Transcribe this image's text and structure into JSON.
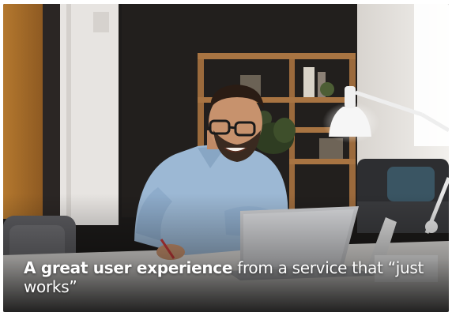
{
  "caption": {
    "bold_text": "A great user experience",
    "regular_text": "from a service that “just works”"
  },
  "image": {
    "subject": "smiling man with glasses writing at a desk in front of a laptop",
    "colors": {
      "shirt": "#9cb8d4",
      "wall": "#1c1a19",
      "shelf": "#a87442",
      "caption_text": "#ffffff"
    }
  }
}
